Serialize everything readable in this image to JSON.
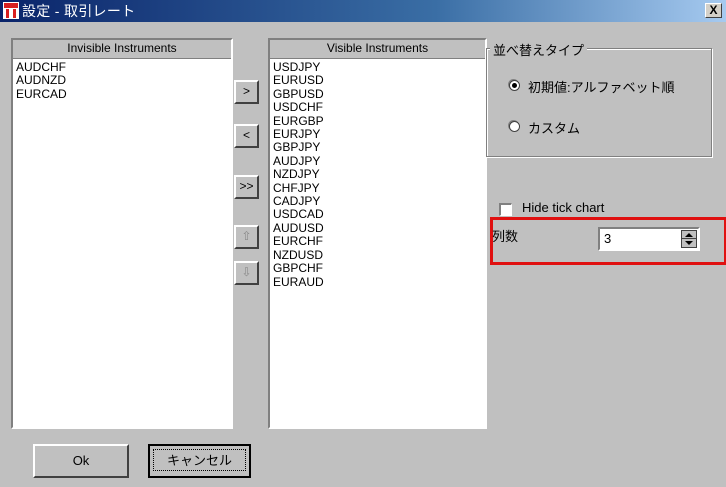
{
  "window": {
    "title": "設定 - 取引レート",
    "close_label": "X"
  },
  "invisible_list": {
    "header": "Invisible Instruments",
    "items": [
      "AUDCHF",
      "AUDNZD",
      "EURCAD"
    ]
  },
  "visible_list": {
    "header": "Visible Instruments",
    "items": [
      "USDJPY",
      "EURUSD",
      "GBPUSD",
      "USDCHF",
      "EURGBP",
      "EURJPY",
      "GBPJPY",
      "AUDJPY",
      "NZDJPY",
      "CHFJPY",
      "CADJPY",
      "USDCAD",
      "AUDUSD",
      "EURCHF",
      "NZDUSD",
      "GBPCHF",
      "EURAUD"
    ]
  },
  "move_buttons": {
    "add": ">",
    "remove": "<",
    "add_all": ">>",
    "up": "⇧",
    "down": "⇩"
  },
  "sort_group": {
    "title": "並べ替えタイプ",
    "options": [
      {
        "label": "初期値:アルファベット順",
        "selected": true
      },
      {
        "label": "カスタム",
        "selected": false
      }
    ]
  },
  "hide_tick_chart": {
    "label": "Hide tick chart",
    "checked": false
  },
  "columns": {
    "label": "列数",
    "value": "3"
  },
  "footer": {
    "ok_label": "Ok",
    "cancel_label": "キャンセル"
  },
  "colors": {
    "highlight": "#e01010",
    "title_bar": "#0a246a"
  }
}
